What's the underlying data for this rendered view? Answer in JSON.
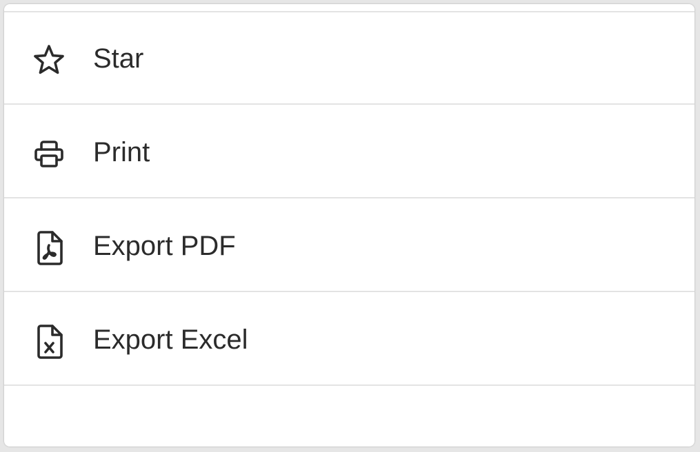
{
  "menu": {
    "items": [
      {
        "id": "star",
        "label": "Star",
        "icon": "star-icon"
      },
      {
        "id": "print",
        "label": "Print",
        "icon": "printer-icon"
      },
      {
        "id": "export-pdf",
        "label": "Export PDF",
        "icon": "pdf-file-icon"
      },
      {
        "id": "export-excel",
        "label": "Export Excel",
        "icon": "excel-file-icon"
      }
    ]
  },
  "colors": {
    "text": "#2b2b2b",
    "divider": "#e3e3e3",
    "background": "#ffffff"
  }
}
